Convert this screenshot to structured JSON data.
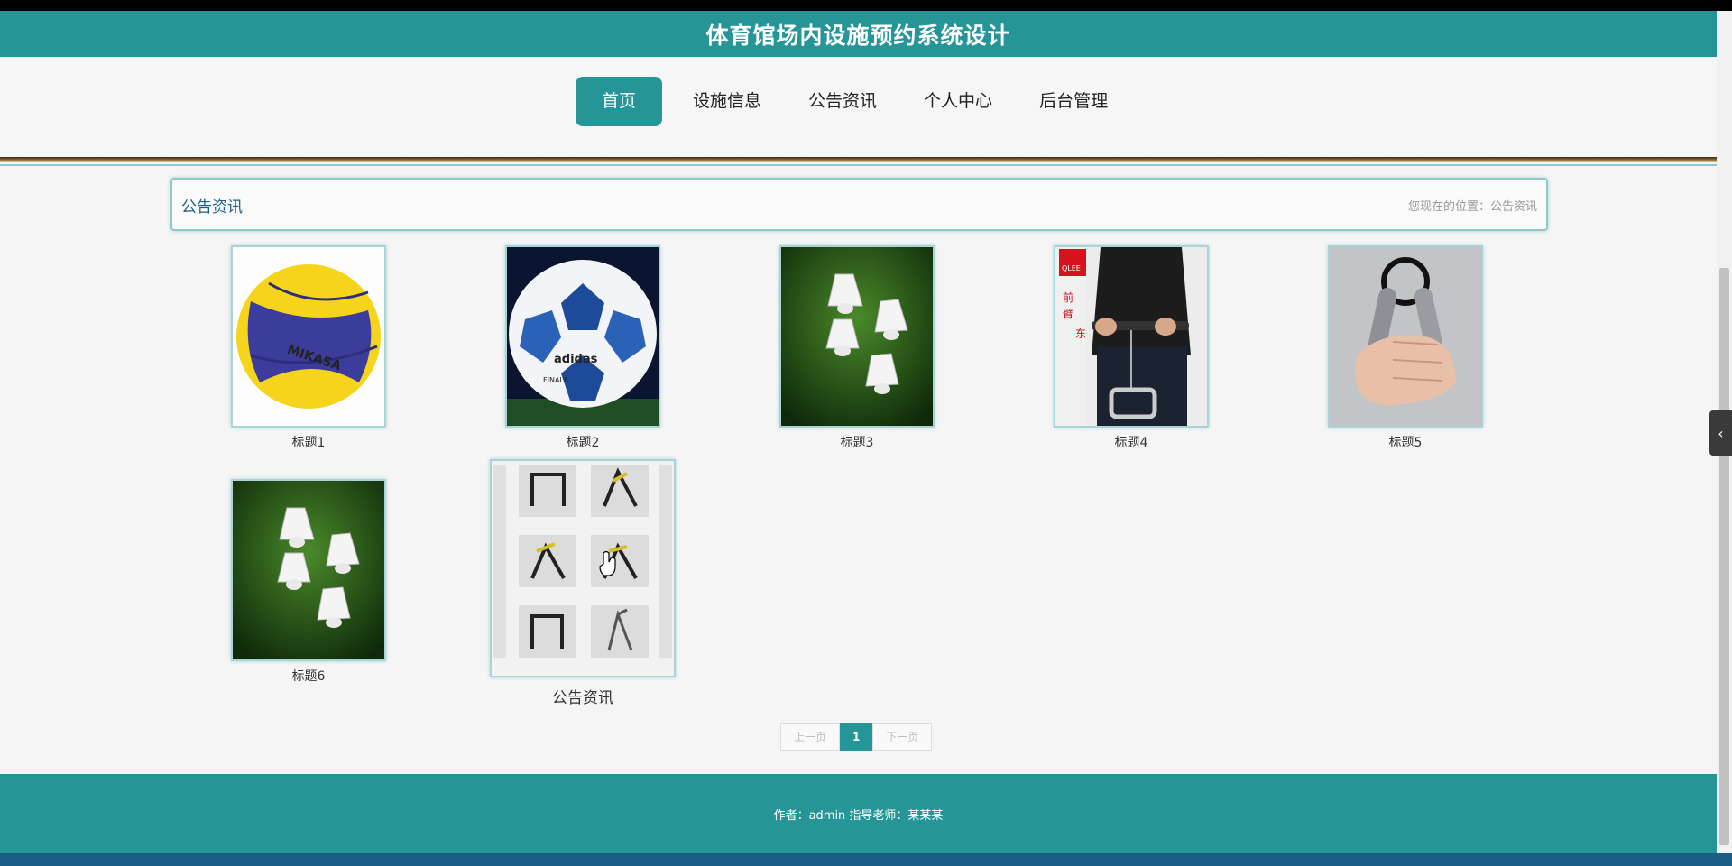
{
  "header": {
    "site_title": "体育馆场内设施预约系统设计"
  },
  "nav": {
    "items": [
      {
        "label": "首页",
        "active": true
      },
      {
        "label": "设施信息",
        "active": false
      },
      {
        "label": "公告资讯",
        "active": false
      },
      {
        "label": "个人中心",
        "active": false
      },
      {
        "label": "后台管理",
        "active": false
      }
    ]
  },
  "breadcrumb": {
    "section_title": "公告资讯",
    "location": "您现在的位置：公告资讯"
  },
  "news": {
    "items": [
      {
        "caption": "标题1",
        "image": "volleyball"
      },
      {
        "caption": "标题2",
        "image": "soccer-ball"
      },
      {
        "caption": "标题3",
        "image": "shuttlecocks"
      },
      {
        "caption": "标题4",
        "image": "wrist-trainer"
      },
      {
        "caption": "标题5",
        "image": "hand-grip"
      },
      {
        "caption": "标题6",
        "image": "shuttlecocks"
      },
      {
        "caption": "公告资讯",
        "image": "gym-machines"
      }
    ]
  },
  "pagination": {
    "prev_label": "上一页",
    "current": "1",
    "next_label": "下一页"
  },
  "footer": {
    "text": "作者：admin 指导老师：某某某"
  },
  "colors": {
    "primary": "#259597",
    "title_text": "#1f5f88"
  }
}
